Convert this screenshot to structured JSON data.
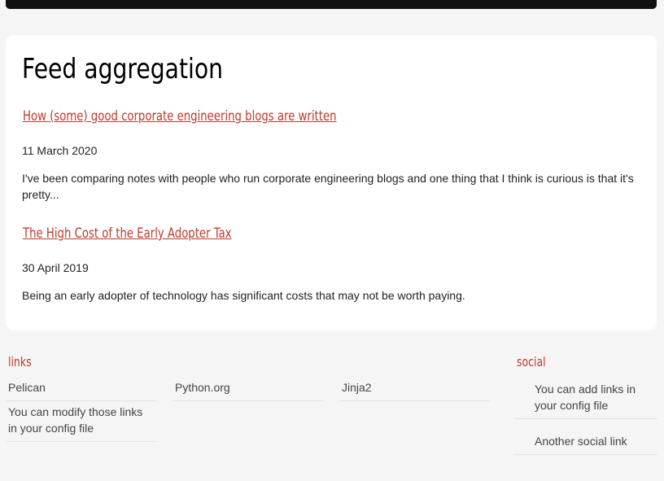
{
  "page": {
    "title": "Feed aggregation"
  },
  "posts": [
    {
      "title": "How (some) good corporate engineering blogs are written",
      "date": "11 March 2020",
      "summary": "I've been comparing notes with people who run corporate engineering blogs and one thing that I think is curious is that it's pretty..."
    },
    {
      "title": "The High Cost of the Early Adopter Tax",
      "date": "30 April 2019",
      "summary": "Being an early adopter of technology has significant costs that may not be worth paying."
    }
  ],
  "links": {
    "heading": "links",
    "items": [
      "Pelican",
      "Python.org",
      "Jinja2",
      "You can modify those links in your config file"
    ]
  },
  "social": {
    "heading": "social",
    "items": [
      "You can add links in your config file",
      "Another social link"
    ]
  },
  "colors": {
    "accent": "#c0392b",
    "topbar": "#111111",
    "background": "#f5f5f5",
    "card": "#ffffff"
  }
}
